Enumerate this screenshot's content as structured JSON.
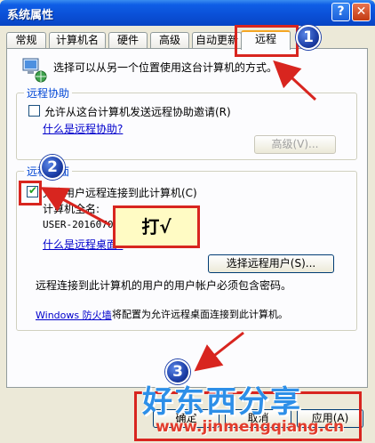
{
  "window": {
    "title": "系统属性",
    "help_label": "?",
    "close_label": "✕"
  },
  "tabs": [
    {
      "label": "常规"
    },
    {
      "label": "计算机名"
    },
    {
      "label": "硬件"
    },
    {
      "label": "高级"
    },
    {
      "label": "自动更新"
    },
    {
      "label": "远程",
      "active": true
    }
  ],
  "intro": {
    "text": "选择可以从另一个位置使用这台计算机的方式。",
    "icon": "computer-network-icon"
  },
  "remote_assistance": {
    "group_label": "远程协助",
    "checkbox_label": "允许从这台计算机发送远程协助邀请(R)",
    "checked": false,
    "help_link": "什么是远程协助?",
    "advanced_button": "高级(V)..."
  },
  "remote_desktop": {
    "group_label": "远程桌面",
    "checkbox_label": "允许用户远程连接到此计算机(C)",
    "checked": true,
    "computer_name_label": "计算机全名:",
    "computer_name_value": "USER-20160701OI",
    "help_link": "什么是远程桌面?",
    "select_users_button": "选择远程用户(S)...",
    "password_note": "远程连接到此计算机的用户的用户帐户必须包含密码。",
    "firewall_link": "Windows 防火墙",
    "firewall_text": "将配置为允许远程桌面连接到此计算机。"
  },
  "footer": {
    "ok_button": "确定",
    "cancel_button": "取消",
    "apply_button": "应用(A)"
  },
  "annotations": {
    "step1": "1",
    "step2": "2",
    "step3": "3",
    "callout": "打√",
    "highlight_color": "#d8251f",
    "badge_color": "#1d3fa8"
  },
  "watermark": {
    "text": "好东西分享",
    "url": "www.jinmengqiang.cn"
  },
  "colors": {
    "titlebar": "#0a4fd6",
    "link": "#0000cc",
    "group_label": "#0046d5",
    "face": "#ece9d8"
  }
}
